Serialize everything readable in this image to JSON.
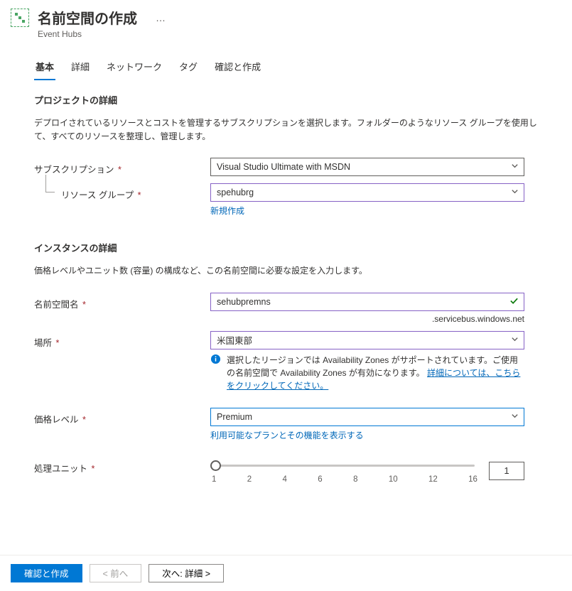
{
  "header": {
    "title": "名前空間の作成",
    "subtitle": "Event Hubs",
    "more": "…"
  },
  "tabs": [
    "基本",
    "詳細",
    "ネットワーク",
    "タグ",
    "確認と作成"
  ],
  "project": {
    "section_title": "プロジェクトの詳細",
    "desc": "デプロイされているリソースとコストを管理するサブスクリプションを選択します。フォルダーのようなリソース グループを使用して、すべてのリソースを整理し、管理します。",
    "subscription": {
      "label": "サブスクリプション",
      "value": "Visual Studio Ultimate with MSDN"
    },
    "resource_group": {
      "label": "リソース グループ",
      "value": "spehubrg",
      "new_link": "新規作成"
    }
  },
  "instance": {
    "section_title": "インスタンスの詳細",
    "desc": "価格レベルやユニット数 (容量) の構成など、この名前空間に必要な設定を入力します。",
    "namespace": {
      "label": "名前空間名",
      "value": "sehubpremns",
      "suffix": ".servicebus.windows.net"
    },
    "location": {
      "label": "場所",
      "value": "米国東部",
      "info_text": "選択したリージョンでは Availability Zones がサポートされています。ご使用の名前空間で Availability Zones が有効になります。",
      "info_link": "詳細については、こちらをクリックしてください。"
    },
    "pricing": {
      "label": "価格レベル",
      "value": "Premium",
      "link": "利用可能なプランとその機能を表示する"
    },
    "units": {
      "label": "処理ユニット",
      "value": "1",
      "ticks": [
        "1",
        "2",
        "4",
        "6",
        "8",
        "10",
        "12",
        "16"
      ]
    }
  },
  "footer": {
    "review": "確認と作成",
    "prev": "< 前へ",
    "next": "次へ: 詳細 >"
  }
}
